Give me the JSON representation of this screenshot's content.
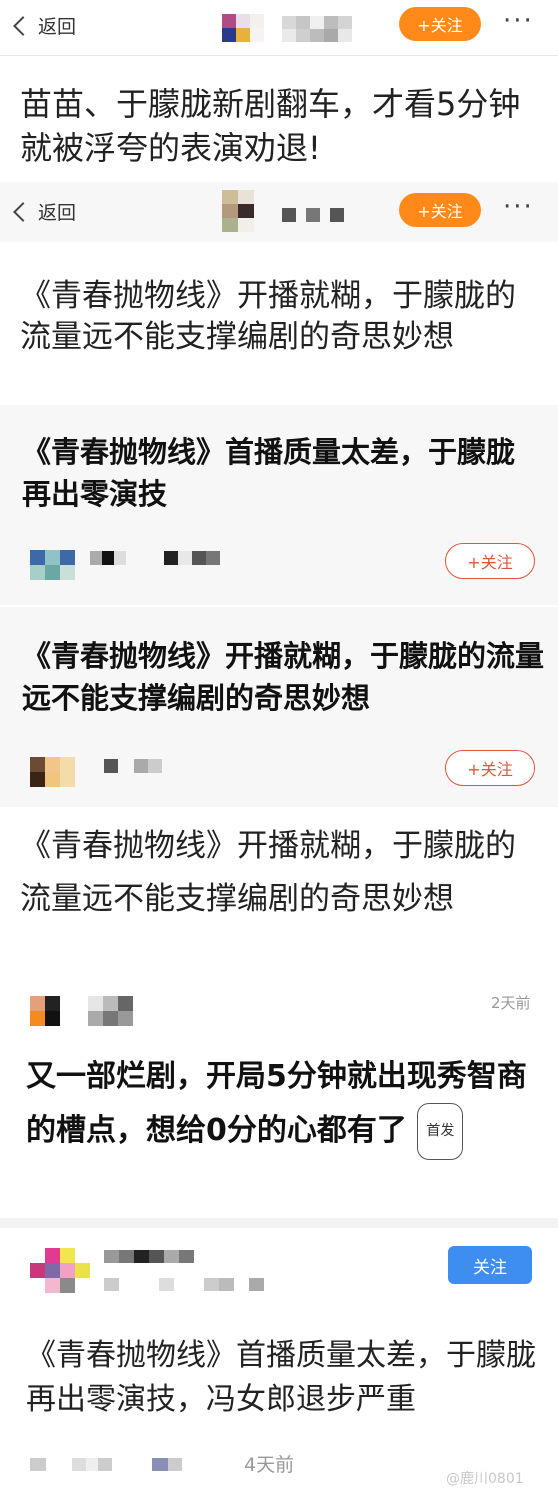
{
  "header1": {
    "back_label": "返回",
    "follow_label": "+关注",
    "more_label": "···"
  },
  "article1_title": "苗苗、于朦胧新剧翻车，才看5分钟就被浮夸的表演劝退!",
  "header2": {
    "back_label": "返回",
    "follow_label": "+关注",
    "more_label": "···"
  },
  "article2_title": "《青春抛物线》开播就糊，于朦胧的流量远不能支撑编剧的奇思妙想",
  "card1": {
    "title": "《青春抛物线》首播质量太差，于朦胧再出零演技",
    "follow_label": "+关注"
  },
  "card2": {
    "title": "《青春抛物线》开播就糊，于朦胧的流量远不能支撑编剧的奇思妙想",
    "follow_label": "+关注"
  },
  "article3_title": "《青春抛物线》开播就糊，于朦胧的流量远不能支撑编剧的奇思妙想",
  "post1": {
    "time": "2天前",
    "title": "又一部烂剧，开局5分钟就出现秀智商的槽点，想给0分的心都有了",
    "badge": "首发"
  },
  "post2": {
    "follow_label": "关注",
    "title": "《青春抛物线》首播质量太差，于朦胧再出零演技，冯女郎退步严重",
    "time": "4天前"
  },
  "watermark": "@鹿川0801",
  "colors": {
    "orange": "#ff8a1a",
    "red_outline": "#e0553a",
    "blue": "#3d8ef0"
  }
}
